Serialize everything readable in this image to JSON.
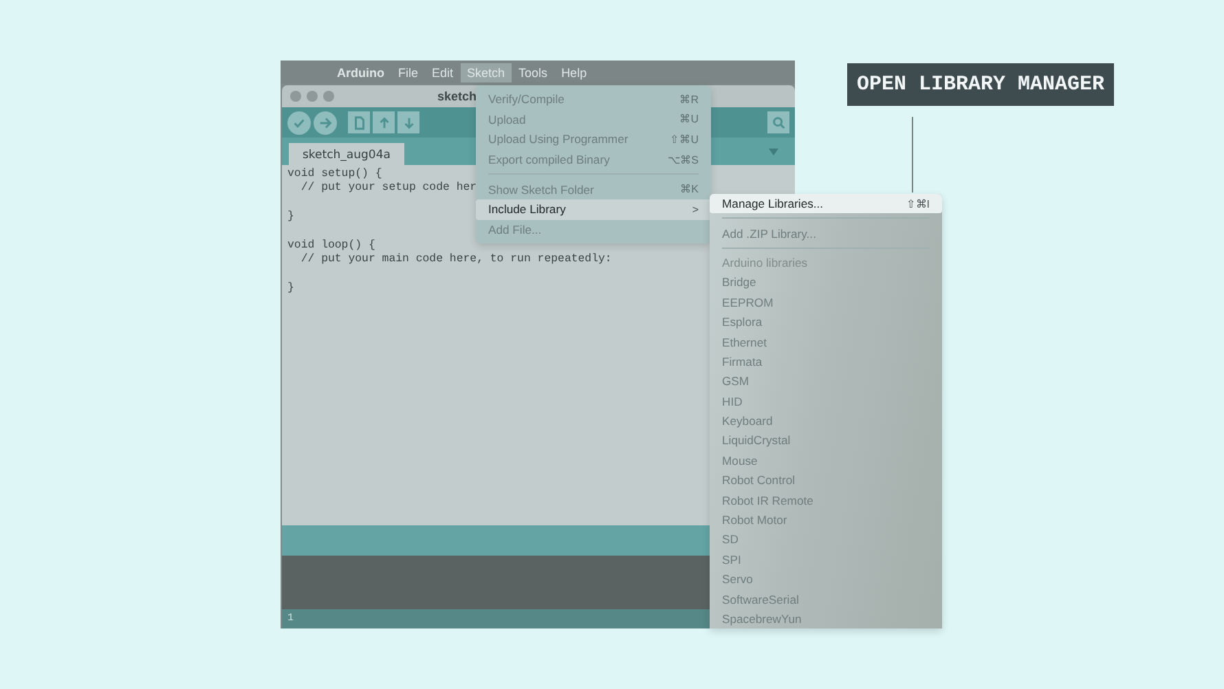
{
  "menu_bar": [
    {
      "label": "Arduino",
      "kind": "app",
      "selected": false
    },
    {
      "label": "File",
      "kind": "menu",
      "selected": false
    },
    {
      "label": "Edit",
      "kind": "menu",
      "selected": false
    },
    {
      "label": "Sketch",
      "kind": "menu",
      "selected": true
    },
    {
      "label": "Tools",
      "kind": "menu",
      "selected": false
    },
    {
      "label": "Help",
      "kind": "menu",
      "selected": false
    }
  ],
  "window": {
    "title": "sketch"
  },
  "tabs": [
    {
      "label": "sketch_aug04a",
      "selected": true
    }
  ],
  "editor": {
    "lines": [
      {
        "kind": "code",
        "text": "void setup() {"
      },
      {
        "kind": "code",
        "text": "  // put your setup code her"
      },
      {
        "kind": "blank"
      },
      {
        "kind": "code",
        "text": "}"
      },
      {
        "kind": "blank"
      },
      {
        "kind": "code",
        "text": "void loop() {"
      },
      {
        "kind": "code",
        "text": "  // put your main code here, to run repeatedly:"
      },
      {
        "kind": "blank"
      },
      {
        "kind": "code",
        "text": "}"
      }
    ]
  },
  "status_bar": {
    "line": "1"
  },
  "sketch_menu": [
    {
      "kind": "item",
      "label": "Verify/Compile",
      "shortcut": "⌘R",
      "selected": false
    },
    {
      "kind": "item",
      "label": "Upload",
      "shortcut": "⌘U",
      "selected": false
    },
    {
      "kind": "item",
      "label": "Upload Using Programmer",
      "shortcut": "⇧⌘U",
      "selected": false
    },
    {
      "kind": "item",
      "label": "Export compiled Binary",
      "shortcut": "⌥⌘S",
      "selected": false
    },
    {
      "kind": "separator"
    },
    {
      "kind": "item",
      "label": "Show Sketch Folder",
      "shortcut": "⌘K",
      "selected": false
    },
    {
      "kind": "submenu",
      "label": "Include Library",
      "arrow": ">",
      "selected": true
    },
    {
      "kind": "item",
      "label": "Add File...",
      "selected": false
    }
  ],
  "library_submenu": [
    {
      "kind": "item",
      "label": "Manage Libraries...",
      "shortcut": "⇧⌘I",
      "selected": true
    },
    {
      "kind": "separator"
    },
    {
      "kind": "item",
      "label": "Add .ZIP Library...",
      "selected": false
    },
    {
      "kind": "separator"
    },
    {
      "kind": "header",
      "label": "Arduino libraries"
    },
    {
      "kind": "item",
      "label": "Bridge",
      "selected": false
    },
    {
      "kind": "item",
      "label": "EEPROM",
      "selected": false
    },
    {
      "kind": "item",
      "label": "Esplora",
      "selected": false
    },
    {
      "kind": "item",
      "label": "Ethernet",
      "selected": false
    },
    {
      "kind": "item",
      "label": "Firmata",
      "selected": false
    },
    {
      "kind": "item",
      "label": "GSM",
      "selected": false
    },
    {
      "kind": "item",
      "label": "HID",
      "selected": false
    },
    {
      "kind": "item",
      "label": "Keyboard",
      "selected": false
    },
    {
      "kind": "item",
      "label": "LiquidCrystal",
      "selected": false
    },
    {
      "kind": "item",
      "label": "Mouse",
      "selected": false
    },
    {
      "kind": "item",
      "label": "Robot Control",
      "selected": false
    },
    {
      "kind": "item",
      "label": "Robot IR Remote",
      "selected": false
    },
    {
      "kind": "item",
      "label": "Robot Motor",
      "selected": false
    },
    {
      "kind": "item",
      "label": "SD",
      "selected": false
    },
    {
      "kind": "item",
      "label": "SPI",
      "selected": false
    },
    {
      "kind": "item",
      "label": "Servo",
      "selected": false
    },
    {
      "kind": "item",
      "label": "SoftwareSerial",
      "selected": false
    },
    {
      "kind": "item",
      "label": "SpacebrewYun",
      "selected": false
    }
  ],
  "callout": {
    "label": "OPEN LIBRARY MANAGER"
  }
}
